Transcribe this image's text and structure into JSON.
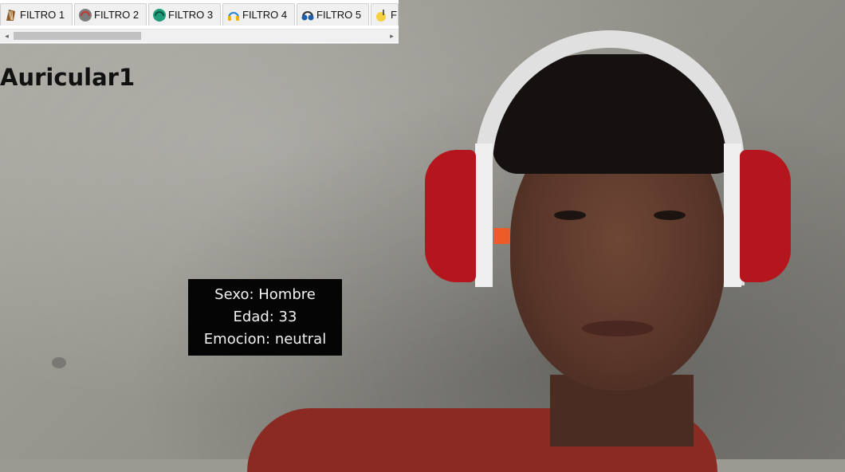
{
  "toolbar": {
    "tabs": [
      {
        "label": "FILTRO 1",
        "icon": "harp-icon",
        "active": false
      },
      {
        "label": "FILTRO 2",
        "icon": "headphones-icon",
        "active": false
      },
      {
        "label": "FILTRO 3",
        "icon": "headphones-icon",
        "active": false
      },
      {
        "label": "FILTRO 4",
        "icon": "headphones-icon",
        "active": false
      },
      {
        "label": "FILTRO 5",
        "icon": "headphones-icon",
        "active": false
      },
      {
        "label": "F",
        "icon": "music-note-icon",
        "active": false
      }
    ],
    "scroll_left": "◂",
    "scroll_right": "▸"
  },
  "filter_title": "Auricular1",
  "info_box": {
    "sexo": "Sexo: Hombre",
    "edad": "Edad: 33",
    "emocion": "Emocion: neutral"
  },
  "colors": {
    "headphone_cup": "#b5151c",
    "headband": "#e0e0e0",
    "marker": "#f05a28"
  }
}
